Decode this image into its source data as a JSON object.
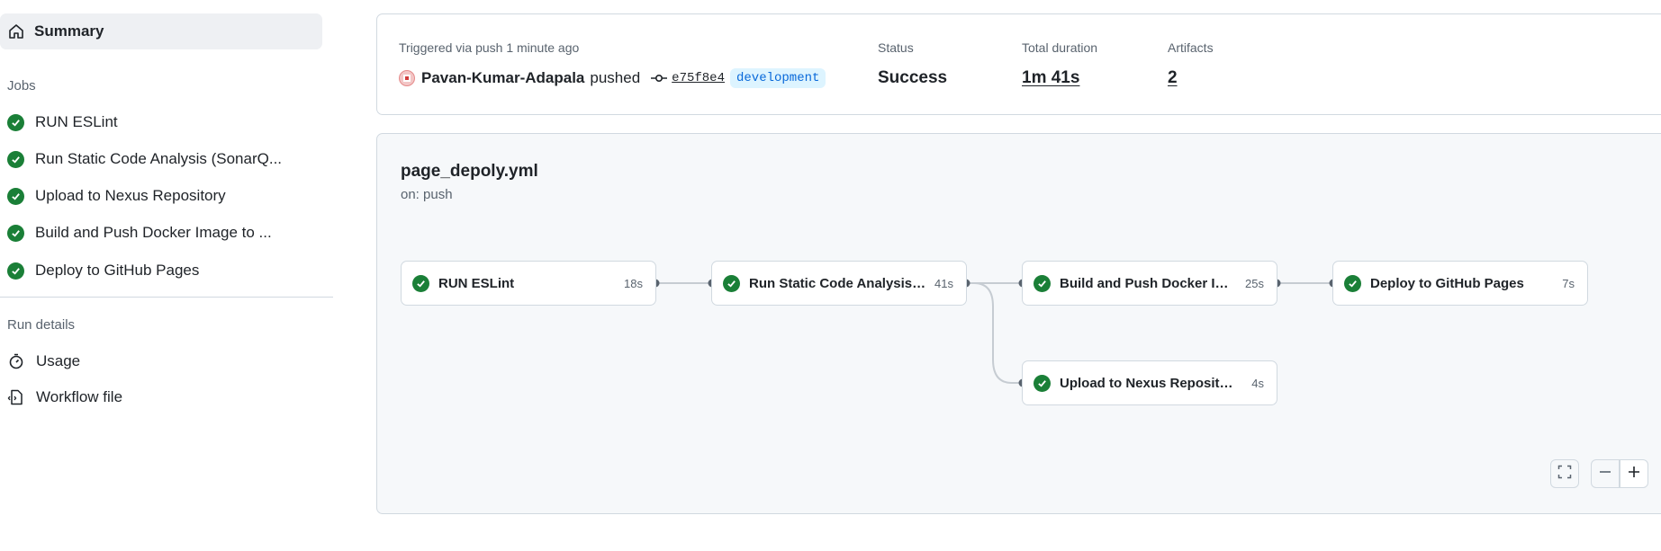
{
  "sidebar": {
    "summary_label": "Summary",
    "jobs_heading": "Jobs",
    "jobs": [
      {
        "label": "RUN ESLint"
      },
      {
        "label": "Run Static Code Analysis (SonarQ..."
      },
      {
        "label": "Upload to Nexus Repository"
      },
      {
        "label": "Build and Push Docker Image to ..."
      },
      {
        "label": "Deploy to GitHub Pages"
      }
    ],
    "run_details_heading": "Run details",
    "details": [
      {
        "label": "Usage",
        "icon": "stopwatch-icon"
      },
      {
        "label": "Workflow file",
        "icon": "file-code-icon"
      }
    ]
  },
  "summary": {
    "trigger_text": "Triggered via push 1 minute ago",
    "actor": "Pavan-Kumar-Adapala",
    "action": "pushed",
    "commit_sha": "e75f8e4",
    "branch": "development",
    "status_label": "Status",
    "status_value": "Success",
    "duration_label": "Total duration",
    "duration_value": "1m 41s",
    "artifacts_label": "Artifacts",
    "artifacts_value": "2"
  },
  "workflow": {
    "name": "page_depoly.yml",
    "trigger": "on: push",
    "jobs": [
      {
        "label": "RUN ESLint",
        "duration": "18s"
      },
      {
        "label": "Run Static Code Analysis (S...",
        "duration": "41s"
      },
      {
        "label": "Build and Push Docker Ima...",
        "duration": "25s"
      },
      {
        "label": "Deploy to GitHub Pages",
        "duration": "7s"
      },
      {
        "label": "Upload to Nexus Repository",
        "duration": "4s"
      }
    ]
  },
  "colors": {
    "success": "#1a7f37",
    "branch_bg": "#ddf4ff",
    "branch_text": "#0969da"
  }
}
